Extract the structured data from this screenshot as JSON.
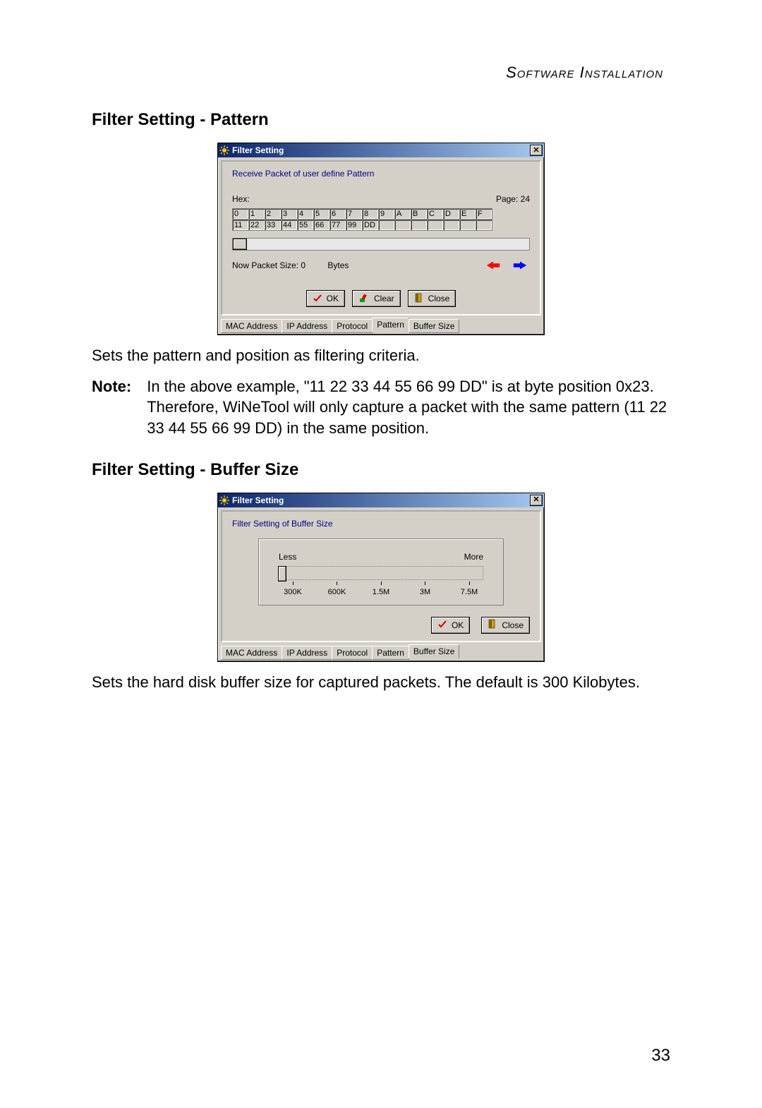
{
  "header": "Software Installation",
  "section1": {
    "heading": "Filter Setting - Pattern",
    "caption": "Sets the pattern and position as filtering criteria.",
    "note_label": "Note:",
    "note_text": "In the above example, \"11 22 33 44 55 66 99 DD\" is at byte position 0x23. Therefore, WiNeTool will only capture a packet with the same pattern (11 22 33 44 55 66 99 DD) in the same position."
  },
  "section2": {
    "heading": "Filter Setting - Buffer Size",
    "caption": "Sets the hard disk buffer size for captured packets. The default is 300 Kilobytes."
  },
  "page_number": "33",
  "dialog1": {
    "title": "Filter Setting",
    "subtitle": "Receive Packet of user define Pattern",
    "hex_label": "Hex:",
    "page_label": "Page: 24",
    "hex_header": [
      "0",
      "1",
      "2",
      "3",
      "4",
      "5",
      "6",
      "7",
      "8",
      "9",
      "A",
      "B",
      "C",
      "D",
      "E",
      "F"
    ],
    "hex_row1": [
      "11",
      "22",
      "33",
      "44",
      "55",
      "66",
      "77",
      "99",
      "DD",
      "",
      "",
      "",
      "",
      "",
      "",
      ""
    ],
    "size_label": "Now Packet Size: 0",
    "bytes_label": "Bytes",
    "ok": "OK",
    "clear": "Clear",
    "close": "Close",
    "tabs": [
      "MAC Address",
      "IP Address",
      "Protocol",
      "Pattern",
      "Buffer Size"
    ],
    "active_tab": "Pattern"
  },
  "dialog2": {
    "title": "Filter Setting",
    "subtitle": "Filter Setting of Buffer Size",
    "less": "Less",
    "more": "More",
    "ticks": [
      "300K",
      "600K",
      "1.5M",
      "3M",
      "7.5M"
    ],
    "ok": "OK",
    "close": "Close",
    "tabs": [
      "MAC Address",
      "IP Address",
      "Protocol",
      "Pattern",
      "Buffer Size"
    ],
    "active_tab": "Buffer Size"
  }
}
